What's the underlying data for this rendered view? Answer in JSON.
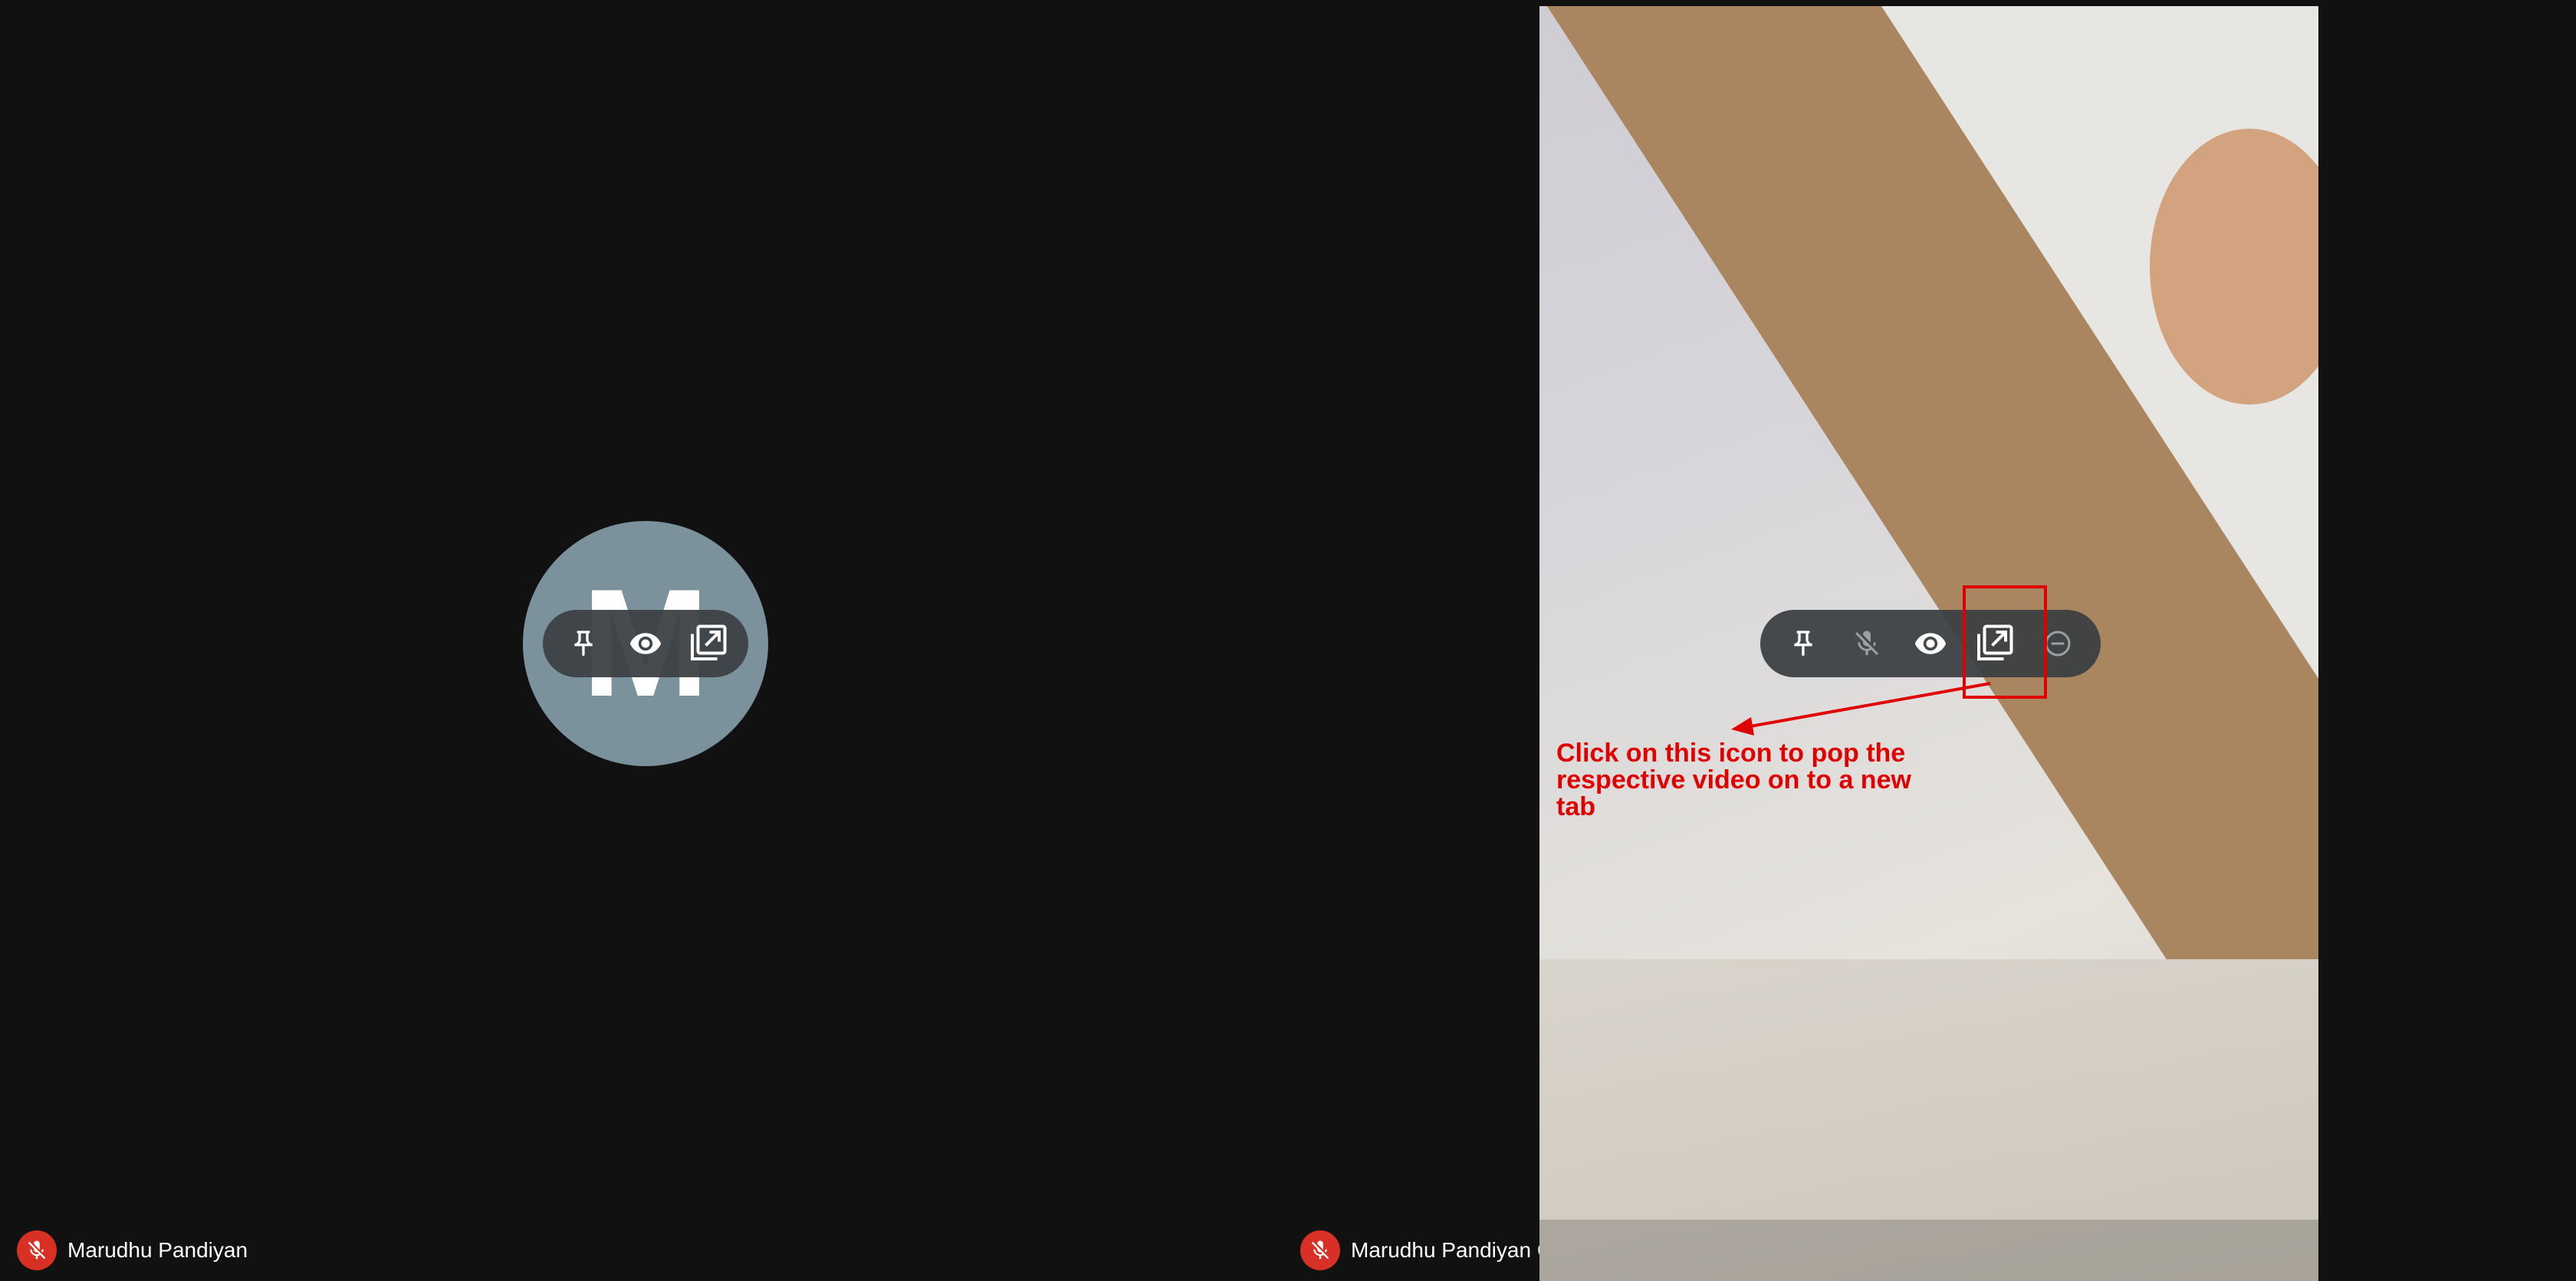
{
  "participants": [
    {
      "name": "Marudhu Pandiyan",
      "avatar_initial": "M",
      "mic_status": "muted",
      "controls": [
        "pin-icon",
        "eye-icon",
        "open-in-new-tab-icon"
      ]
    },
    {
      "name": "Marudhu Pandiyan G",
      "mic_status": "muted",
      "video": "camera feed",
      "controls": [
        "pin-icon",
        "mic-off-icon",
        "eye-icon",
        "open-in-new-tab-icon",
        "remove-icon"
      ]
    }
  ],
  "annotation": {
    "text": "Click on this icon to pop the respective video on to a new tab",
    "color": "#e00000"
  },
  "colors": {
    "background": "#111112",
    "avatar": "#7b919c",
    "mic_off_badge": "#d93025",
    "control_pill": "#3c4043"
  }
}
